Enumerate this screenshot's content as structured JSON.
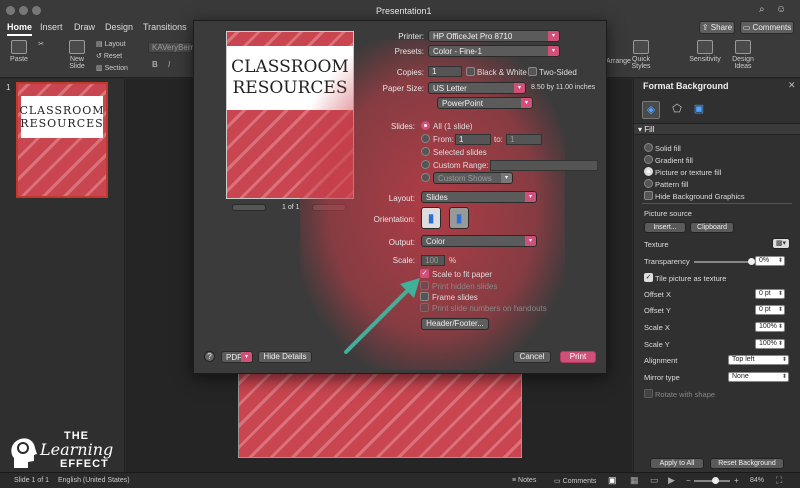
{
  "window": {
    "title": "Presentation1"
  },
  "ribbon": {
    "tabs": [
      "Home",
      "Insert",
      "Draw",
      "Design",
      "Transitions"
    ],
    "paste": "Paste",
    "new_slide": "New Slide",
    "layout": "Layout",
    "reset": "Reset",
    "section": "Section",
    "font_name": "KAVeryBerry!",
    "share": "Share",
    "comments": "Comments",
    "arrange": "Arrange",
    "quick_styles": "Quick Styles",
    "sensitivity": "Sensitivity",
    "design_ideas": "Design Ideas"
  },
  "slide": {
    "number": "1",
    "line1": "CLASSROOM",
    "line2": "RESOURCES"
  },
  "print": {
    "preview_page": "1 of 1",
    "printer_label": "Printer:",
    "printer": "HP OfficeJet Pro 8710",
    "presets_label": "Presets:",
    "presets": "Color - Fine-1",
    "copies_label": "Copies:",
    "copies": "1",
    "black_white": "Black & White",
    "two_sided": "Two-Sided",
    "paper_size_label": "Paper Size:",
    "paper_size": "US Letter",
    "paper_dims": "8.50 by 11.00 inches",
    "app_menu": "PowerPoint",
    "slides_label": "Slides:",
    "all": "All  (1 slide)",
    "from": "From:",
    "from_val": "1",
    "to": "to:",
    "to_val": "1",
    "selected_slides": "Selected slides",
    "custom_range": "Custom Range:",
    "custom_shows": "Custom Shows",
    "layout_label": "Layout:",
    "layout": "Slides",
    "orientation_label": "Orientation:",
    "output_label": "Output:",
    "output": "Color",
    "scale_label": "Scale:",
    "scale_val": "100",
    "scale_unit": "%",
    "scale_to_fit": "Scale to fit paper",
    "print_hidden": "Print hidden slides",
    "frame_slides": "Frame slides",
    "print_numbers": "Print slide numbers on handouts",
    "header_footer": "Header/Footer...",
    "help": "?",
    "pdf": "PDF",
    "hide_details": "Hide Details",
    "cancel": "Cancel",
    "print": "Print"
  },
  "format_bg": {
    "title": "Format Background",
    "fill_section": "Fill",
    "solid": "Solid fill",
    "gradient": "Gradient fill",
    "picture": "Picture or texture fill",
    "pattern": "Pattern fill",
    "hide_graphics": "Hide Background Graphics",
    "picture_source": "Picture source",
    "insert": "Insert...",
    "clipboard": "Clipboard",
    "texture": "Texture",
    "transparency": "Transparency",
    "transparency_val": "0%",
    "transparency_level": 0,
    "tile": "Tile picture as texture",
    "offset_x": "Offset X",
    "offset_x_val": "0 pt",
    "offset_y": "Offset Y",
    "offset_y_val": "0 pt",
    "scale_x": "Scale X",
    "scale_x_val": "100%",
    "scale_y": "Scale Y",
    "scale_y_val": "100%",
    "alignment": "Alignment",
    "alignment_val": "Top left",
    "mirror": "Mirror type",
    "mirror_val": "None",
    "rotate": "Rotate with shape",
    "apply_all": "Apply to All",
    "reset_bg": "Reset Background"
  },
  "status": {
    "slide_of": "Slide 1 of 1",
    "language": "English (United States)",
    "notes": "Notes",
    "comments": "Comments",
    "zoom": "84%"
  },
  "logo": {
    "line1": "THE",
    "line2": "Learning",
    "line3": "EFFECT"
  },
  "colors": {
    "accent": "#d0507a",
    "arrow": "#3fb09a",
    "slide_red": "#c9454f"
  }
}
